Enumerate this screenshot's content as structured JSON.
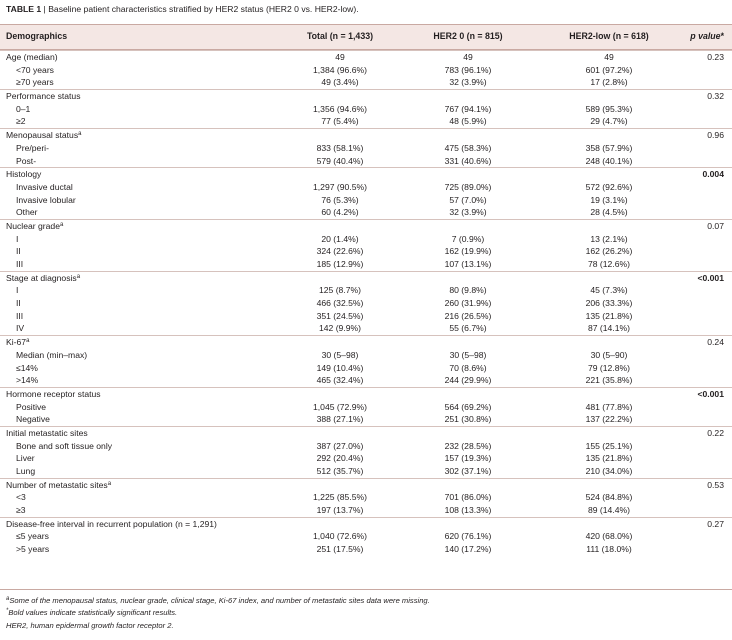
{
  "caption": {
    "label": "TABLE 1",
    "separator": " | ",
    "text": "Baseline patient characteristics stratified by HER2 status (HER2 0 vs. HER2-low)."
  },
  "header": {
    "demographics": "Demographics",
    "total": "Total (n = 1,433)",
    "her2_0": "HER2 0 (n = 815)",
    "her2_low": "HER2-low (n = 618)",
    "p_value_label": "p value",
    "p_value_mark": "*"
  },
  "rows": [
    {
      "label": "Age (median)",
      "sup": "",
      "section": true,
      "sub": false,
      "total": "49",
      "her2_0": "49",
      "her2_low": "49",
      "p": "0.23",
      "bold": false
    },
    {
      "label": "<70 years",
      "sup": "",
      "section": false,
      "sub": true,
      "total": "1,384 (96.6%)",
      "her2_0": "783 (96.1%)",
      "her2_low": "601 (97.2%)",
      "p": "",
      "bold": false
    },
    {
      "label": "≥70 years",
      "sup": "",
      "section": false,
      "sub": true,
      "total": "49 (3.4%)",
      "her2_0": "32 (3.9%)",
      "her2_low": "17 (2.8%)",
      "p": "",
      "bold": false
    },
    {
      "label": "Performance status",
      "sup": "",
      "section": true,
      "sub": false,
      "total": "",
      "her2_0": "",
      "her2_low": "",
      "p": "0.32",
      "bold": false
    },
    {
      "label": "0–1",
      "sup": "",
      "section": false,
      "sub": true,
      "total": "1,356 (94.6%)",
      "her2_0": "767 (94.1%)",
      "her2_low": "589 (95.3%)",
      "p": "",
      "bold": false
    },
    {
      "label": "≥2",
      "sup": "",
      "section": false,
      "sub": true,
      "total": "77 (5.4%)",
      "her2_0": "48 (5.9%)",
      "her2_low": "29 (4.7%)",
      "p": "",
      "bold": false
    },
    {
      "label": "Menopausal status",
      "sup": "a",
      "section": true,
      "sub": false,
      "total": "",
      "her2_0": "",
      "her2_low": "",
      "p": "0.96",
      "bold": false
    },
    {
      "label": "Pre/peri-",
      "sup": "",
      "section": false,
      "sub": true,
      "total": "833 (58.1%)",
      "her2_0": "475 (58.3%)",
      "her2_low": "358 (57.9%)",
      "p": "",
      "bold": false
    },
    {
      "label": "Post-",
      "sup": "",
      "section": false,
      "sub": true,
      "total": "579 (40.4%)",
      "her2_0": "331 (40.6%)",
      "her2_low": "248 (40.1%)",
      "p": "",
      "bold": false
    },
    {
      "label": "Histology",
      "sup": "",
      "section": true,
      "sub": false,
      "total": "",
      "her2_0": "",
      "her2_low": "",
      "p": "0.004",
      "bold": true
    },
    {
      "label": "Invasive ductal",
      "sup": "",
      "section": false,
      "sub": true,
      "total": "1,297 (90.5%)",
      "her2_0": "725 (89.0%)",
      "her2_low": "572 (92.6%)",
      "p": "",
      "bold": false
    },
    {
      "label": "Invasive lobular",
      "sup": "",
      "section": false,
      "sub": true,
      "total": "76 (5.3%)",
      "her2_0": "57 (7.0%)",
      "her2_low": "19 (3.1%)",
      "p": "",
      "bold": false
    },
    {
      "label": "Other",
      "sup": "",
      "section": false,
      "sub": true,
      "total": "60 (4.2%)",
      "her2_0": "32 (3.9%)",
      "her2_low": "28 (4.5%)",
      "p": "",
      "bold": false
    },
    {
      "label": "Nuclear grade",
      "sup": "a",
      "section": true,
      "sub": false,
      "total": "",
      "her2_0": "",
      "her2_low": "",
      "p": "0.07",
      "bold": false
    },
    {
      "label": "I",
      "sup": "",
      "section": false,
      "sub": true,
      "total": "20 (1.4%)",
      "her2_0": "7 (0.9%)",
      "her2_low": "13 (2.1%)",
      "p": "",
      "bold": false
    },
    {
      "label": "II",
      "sup": "",
      "section": false,
      "sub": true,
      "total": "324 (22.6%)",
      "her2_0": "162 (19.9%)",
      "her2_low": "162 (26.2%)",
      "p": "",
      "bold": false
    },
    {
      "label": "III",
      "sup": "",
      "section": false,
      "sub": true,
      "total": "185 (12.9%)",
      "her2_0": "107 (13.1%)",
      "her2_low": "78 (12.6%)",
      "p": "",
      "bold": false
    },
    {
      "label": "Stage at diagnosis",
      "sup": "a",
      "section": true,
      "sub": false,
      "total": "",
      "her2_0": "",
      "her2_low": "",
      "p": "<0.001",
      "bold": true
    },
    {
      "label": "I",
      "sup": "",
      "section": false,
      "sub": true,
      "total": "125 (8.7%)",
      "her2_0": "80 (9.8%)",
      "her2_low": "45 (7.3%)",
      "p": "",
      "bold": false
    },
    {
      "label": "II",
      "sup": "",
      "section": false,
      "sub": true,
      "total": "466 (32.5%)",
      "her2_0": "260 (31.9%)",
      "her2_low": "206 (33.3%)",
      "p": "",
      "bold": false
    },
    {
      "label": "III",
      "sup": "",
      "section": false,
      "sub": true,
      "total": "351 (24.5%)",
      "her2_0": "216 (26.5%)",
      "her2_low": "135 (21.8%)",
      "p": "",
      "bold": false
    },
    {
      "label": "IV",
      "sup": "",
      "section": false,
      "sub": true,
      "total": "142 (9.9%)",
      "her2_0": "55 (6.7%)",
      "her2_low": "87 (14.1%)",
      "p": "",
      "bold": false
    },
    {
      "label": "Ki-67",
      "sup": "a",
      "section": true,
      "sub": false,
      "total": "",
      "her2_0": "",
      "her2_low": "",
      "p": "0.24",
      "bold": false
    },
    {
      "label": "Median (min–max)",
      "sup": "",
      "section": false,
      "sub": true,
      "total": "30 (5–98)",
      "her2_0": "30 (5–98)",
      "her2_low": "30 (5–90)",
      "p": "",
      "bold": false
    },
    {
      "label": "≤14%",
      "sup": "",
      "section": false,
      "sub": true,
      "total": "149 (10.4%)",
      "her2_0": "70 (8.6%)",
      "her2_low": "79 (12.8%)",
      "p": "",
      "bold": false
    },
    {
      "label": ">14%",
      "sup": "",
      "section": false,
      "sub": true,
      "total": "465 (32.4%)",
      "her2_0": "244 (29.9%)",
      "her2_low": "221 (35.8%)",
      "p": "",
      "bold": false
    },
    {
      "label": "Hormone receptor status",
      "sup": "",
      "section": true,
      "sub": false,
      "total": "",
      "her2_0": "",
      "her2_low": "",
      "p": "<0.001",
      "bold": true
    },
    {
      "label": "Positive",
      "sup": "",
      "section": false,
      "sub": true,
      "total": "1,045 (72.9%)",
      "her2_0": "564 (69.2%)",
      "her2_low": "481 (77.8%)",
      "p": "",
      "bold": false
    },
    {
      "label": "Negative",
      "sup": "",
      "section": false,
      "sub": true,
      "total": "388 (27.1%)",
      "her2_0": "251 (30.8%)",
      "her2_low": "137 (22.2%)",
      "p": "",
      "bold": false
    },
    {
      "label": "Initial metastatic sites",
      "sup": "",
      "section": true,
      "sub": false,
      "total": "",
      "her2_0": "",
      "her2_low": "",
      "p": "0.22",
      "bold": false
    },
    {
      "label": "Bone and soft tissue only",
      "sup": "",
      "section": false,
      "sub": true,
      "total": "387 (27.0%)",
      "her2_0": "232 (28.5%)",
      "her2_low": "155 (25.1%)",
      "p": "",
      "bold": false
    },
    {
      "label": "Liver",
      "sup": "",
      "section": false,
      "sub": true,
      "total": "292 (20.4%)",
      "her2_0": "157 (19.3%)",
      "her2_low": "135 (21.8%)",
      "p": "",
      "bold": false
    },
    {
      "label": "Lung",
      "sup": "",
      "section": false,
      "sub": true,
      "total": "512 (35.7%)",
      "her2_0": "302 (37.1%)",
      "her2_low": "210 (34.0%)",
      "p": "",
      "bold": false
    },
    {
      "label": "Number of metastatic sites",
      "sup": "a",
      "section": true,
      "sub": false,
      "total": "",
      "her2_0": "",
      "her2_low": "",
      "p": "0.53",
      "bold": false
    },
    {
      "label": "<3",
      "sup": "",
      "section": false,
      "sub": true,
      "total": "1,225 (85.5%)",
      "her2_0": "701 (86.0%)",
      "her2_low": "524 (84.8%)",
      "p": "",
      "bold": false
    },
    {
      "label": "≥3",
      "sup": "",
      "section": false,
      "sub": true,
      "total": "197 (13.7%)",
      "her2_0": "108 (13.3%)",
      "her2_low": "89 (14.4%)",
      "p": "",
      "bold": false
    },
    {
      "label": "Disease-free interval in recurrent population (n = 1,291)",
      "sup": "",
      "section": true,
      "sub": false,
      "total": "",
      "her2_0": "",
      "her2_low": "",
      "p": "0.27",
      "bold": false
    },
    {
      "label": "≤5 years",
      "sup": "",
      "section": false,
      "sub": true,
      "total": "1,040 (72.6%)",
      "her2_0": "620 (76.1%)",
      "her2_low": "420 (68.0%)",
      "p": "",
      "bold": false
    },
    {
      "label": ">5 years",
      "sup": "",
      "section": false,
      "sub": true,
      "total": "251 (17.5%)",
      "her2_0": "140 (17.2%)",
      "her2_low": "111 (18.0%)",
      "p": "",
      "bold": false
    }
  ],
  "footnotes": [
    {
      "mark": "a",
      "text": "Some of the menopausal status, nuclear grade, clinical stage, Ki-67 index, and number of metastatic sites data were missing."
    },
    {
      "mark": "*",
      "text": "Bold values indicate statistically significant results."
    },
    {
      "mark": "",
      "text": "HER2, human epidermal growth factor receptor 2."
    }
  ]
}
